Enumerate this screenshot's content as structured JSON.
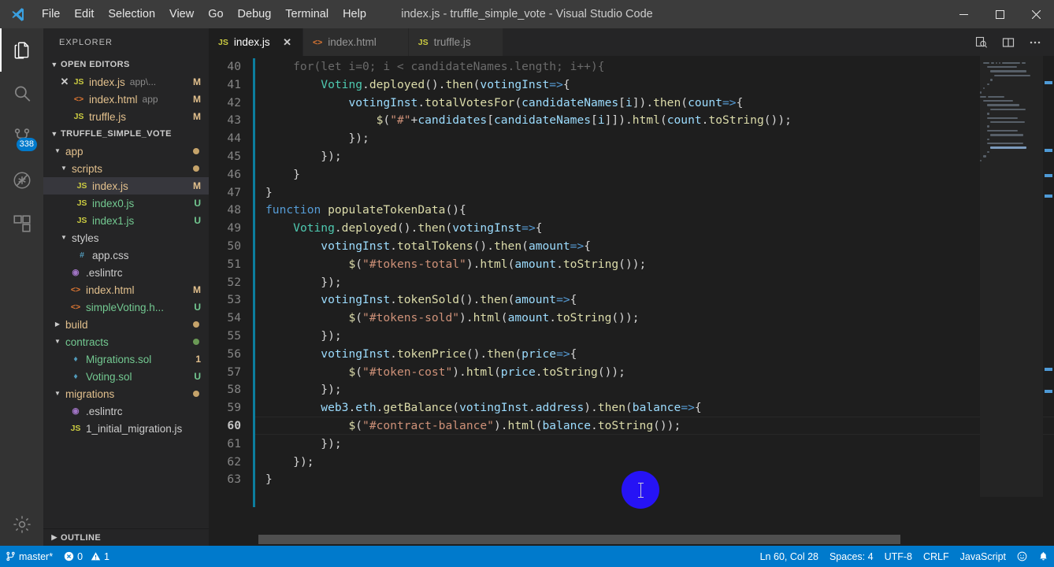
{
  "window": {
    "title": "index.js - truffle_simple_vote - Visual Studio Code",
    "minimize_label": "Minimize",
    "maximize_label": "Maximize",
    "close_label": "Close"
  },
  "menu": [
    {
      "label": "File"
    },
    {
      "label": "Edit"
    },
    {
      "label": "Selection"
    },
    {
      "label": "View"
    },
    {
      "label": "Go"
    },
    {
      "label": "Debug"
    },
    {
      "label": "Terminal"
    },
    {
      "label": "Help"
    }
  ],
  "activitybar": [
    {
      "name": "explorer",
      "icon": "files-icon",
      "active": true,
      "badge": ""
    },
    {
      "name": "search",
      "icon": "search-icon",
      "active": false,
      "badge": ""
    },
    {
      "name": "source-control",
      "icon": "source-control-icon",
      "active": false,
      "badge": "338"
    },
    {
      "name": "debug",
      "icon": "debug-icon",
      "active": false,
      "badge": ""
    },
    {
      "name": "extensions",
      "icon": "extensions-icon",
      "active": false,
      "badge": ""
    },
    {
      "name": "settings",
      "icon": "gear-icon",
      "active": false,
      "badge": ""
    }
  ],
  "sidebar": {
    "title": "EXPLORER",
    "open_editors": {
      "label": "OPEN EDITORS",
      "items": [
        {
          "icon": "js",
          "name": "index.js",
          "sub": "app\\...",
          "badge": "M",
          "badge_kind": "M",
          "name_kind": "mod",
          "closable": true,
          "selected": false
        },
        {
          "icon": "html",
          "name": "index.html",
          "sub": "app",
          "badge": "M",
          "badge_kind": "M",
          "name_kind": "mod",
          "closable": false,
          "selected": false
        },
        {
          "icon": "js",
          "name": "truffle.js",
          "sub": "",
          "badge": "M",
          "badge_kind": "M",
          "name_kind": "mod",
          "closable": false,
          "selected": false
        }
      ]
    },
    "project": {
      "label": "TRUFFLE_SIMPLE_VOTE",
      "items": [
        {
          "indent": 1,
          "twisty": "down",
          "icon": "",
          "name": "app",
          "badge": "",
          "badge_kind": "dot-orange",
          "name_kind": "mod",
          "selected": false
        },
        {
          "indent": 2,
          "twisty": "down",
          "icon": "",
          "name": "scripts",
          "badge": "",
          "badge_kind": "dot-orange",
          "name_kind": "mod",
          "selected": false
        },
        {
          "indent": 3,
          "twisty": "none",
          "icon": "js",
          "name": "index.js",
          "badge": "M",
          "badge_kind": "M",
          "name_kind": "mod",
          "selected": true
        },
        {
          "indent": 3,
          "twisty": "none",
          "icon": "js",
          "name": "index0.js",
          "badge": "U",
          "badge_kind": "U",
          "name_kind": "untracked",
          "selected": false
        },
        {
          "indent": 3,
          "twisty": "none",
          "icon": "js",
          "name": "index1.js",
          "badge": "U",
          "badge_kind": "U",
          "name_kind": "untracked",
          "selected": false
        },
        {
          "indent": 2,
          "twisty": "down",
          "icon": "",
          "name": "styles",
          "badge": "",
          "badge_kind": "",
          "name_kind": "default",
          "selected": false
        },
        {
          "indent": 3,
          "twisty": "none",
          "icon": "css",
          "name": "app.css",
          "badge": "",
          "badge_kind": "",
          "name_kind": "default",
          "selected": false
        },
        {
          "indent": 2,
          "twisty": "none",
          "icon": "eslint",
          "name": ".eslintrc",
          "badge": "",
          "badge_kind": "",
          "name_kind": "default",
          "selected": false
        },
        {
          "indent": 2,
          "twisty": "none",
          "icon": "html",
          "name": "index.html",
          "badge": "M",
          "badge_kind": "M",
          "name_kind": "mod",
          "selected": false
        },
        {
          "indent": 2,
          "twisty": "none",
          "icon": "html",
          "name": "simpleVoting.h...",
          "badge": "U",
          "badge_kind": "U",
          "name_kind": "untracked",
          "selected": false
        },
        {
          "indent": 1,
          "twisty": "right",
          "icon": "",
          "name": "build",
          "badge": "",
          "badge_kind": "dot-orange",
          "name_kind": "mod",
          "selected": false
        },
        {
          "indent": 1,
          "twisty": "down",
          "icon": "",
          "name": "contracts",
          "badge": "",
          "badge_kind": "dot-green",
          "name_kind": "untracked",
          "selected": false
        },
        {
          "indent": 2,
          "twisty": "none",
          "icon": "sol",
          "name": "Migrations.sol",
          "badge": "1",
          "badge_kind": "num",
          "name_kind": "untracked",
          "selected": false
        },
        {
          "indent": 2,
          "twisty": "none",
          "icon": "sol",
          "name": "Voting.sol",
          "badge": "U",
          "badge_kind": "U",
          "name_kind": "untracked",
          "selected": false
        },
        {
          "indent": 1,
          "twisty": "down",
          "icon": "",
          "name": "migrations",
          "badge": "",
          "badge_kind": "dot-orange",
          "name_kind": "mod",
          "selected": false
        },
        {
          "indent": 2,
          "twisty": "none",
          "icon": "eslint",
          "name": ".eslintrc",
          "badge": "",
          "badge_kind": "",
          "name_kind": "default",
          "selected": false
        },
        {
          "indent": 2,
          "twisty": "none",
          "icon": "js",
          "name": "1_initial_migration.js",
          "badge": "",
          "badge_kind": "",
          "name_kind": "default",
          "selected": false
        }
      ]
    },
    "outline_label": "OUTLINE"
  },
  "tabs": [
    {
      "icon": "js",
      "label": "index.js",
      "active": true,
      "closable": true
    },
    {
      "icon": "html",
      "label": "index.html",
      "active": false,
      "closable": false
    },
    {
      "icon": "js",
      "label": "truffle.js",
      "active": false,
      "closable": false
    }
  ],
  "editor_actions": [
    {
      "name": "open-changes-icon"
    },
    {
      "name": "split-editor-icon"
    },
    {
      "name": "more-actions-icon"
    }
  ],
  "code": {
    "first_line": 40,
    "current_line": 60,
    "lines": [
      {
        "no": 40,
        "html": "<span class='t-dim'>    for(let i=0; i &lt; candidateNames.length; i++){</span>"
      },
      {
        "no": 41,
        "html": "        <span class='t-cls'>Voting</span><span class='t-pun'>.</span><span class='t-fn'>deployed</span><span class='t-pun'>().</span><span class='t-fn'>then</span><span class='t-pun'>(</span><span class='t-var'>votingInst</span><span class='t-kw'>=&gt;</span><span class='t-pun'>{</span>"
      },
      {
        "no": 42,
        "html": "            <span class='t-var'>votingInst</span><span class='t-pun'>.</span><span class='t-fn'>totalVotesFor</span><span class='t-pun'>(</span><span class='t-var'>candidateNames</span><span class='t-pun'>[</span><span class='t-var'>i</span><span class='t-pun'>]).</span><span class='t-fn'>then</span><span class='t-pun'>(</span><span class='t-var'>count</span><span class='t-kw'>=&gt;</span><span class='t-pun'>{</span>"
      },
      {
        "no": 43,
        "html": "                <span class='t-fn'>$</span><span class='t-pun'>(</span><span class='t-str'>\"#\"</span><span class='t-op'>+</span><span class='t-var'>candidates</span><span class='t-pun'>[</span><span class='t-var'>candidateNames</span><span class='t-pun'>[</span><span class='t-var'>i</span><span class='t-pun'>]]).</span><span class='t-fn'>html</span><span class='t-pun'>(</span><span class='t-var'>count</span><span class='t-pun'>.</span><span class='t-fn'>toString</span><span class='t-pun'>());</span>"
      },
      {
        "no": 44,
        "html": "            <span class='t-pun'>});</span>"
      },
      {
        "no": 45,
        "html": "        <span class='t-pun'>});</span>"
      },
      {
        "no": 46,
        "html": "    <span class='t-pun'>}</span>"
      },
      {
        "no": 47,
        "html": "<span class='t-pun'>}</span>"
      },
      {
        "no": 48,
        "html": "<span class='t-kw'>function</span> <span class='t-fn'>populateTokenData</span><span class='t-pun'>(){</span>"
      },
      {
        "no": 49,
        "html": "    <span class='t-cls'>Voting</span><span class='t-pun'>.</span><span class='t-fn'>deployed</span><span class='t-pun'>().</span><span class='t-fn'>then</span><span class='t-pun'>(</span><span class='t-var'>votingInst</span><span class='t-kw'>=&gt;</span><span class='t-pun'>{</span>"
      },
      {
        "no": 50,
        "html": "        <span class='t-var'>votingInst</span><span class='t-pun'>.</span><span class='t-fn'>totalTokens</span><span class='t-pun'>().</span><span class='t-fn'>then</span><span class='t-pun'>(</span><span class='t-var'>amount</span><span class='t-kw'>=&gt;</span><span class='t-pun'>{</span>"
      },
      {
        "no": 51,
        "html": "            <span class='t-fn'>$</span><span class='t-pun'>(</span><span class='t-str'>\"#tokens-total\"</span><span class='t-pun'>).</span><span class='t-fn'>html</span><span class='t-pun'>(</span><span class='t-var'>amount</span><span class='t-pun'>.</span><span class='t-fn'>toString</span><span class='t-pun'>());</span>"
      },
      {
        "no": 52,
        "html": "        <span class='t-pun'>});</span>"
      },
      {
        "no": 53,
        "html": "        <span class='t-var'>votingInst</span><span class='t-pun'>.</span><span class='t-fn'>tokenSold</span><span class='t-pun'>().</span><span class='t-fn'>then</span><span class='t-pun'>(</span><span class='t-var'>amount</span><span class='t-kw'>=&gt;</span><span class='t-pun'>{</span>"
      },
      {
        "no": 54,
        "html": "            <span class='t-fn'>$</span><span class='t-pun'>(</span><span class='t-str'>\"#tokens-sold\"</span><span class='t-pun'>).</span><span class='t-fn'>html</span><span class='t-pun'>(</span><span class='t-var'>amount</span><span class='t-pun'>.</span><span class='t-fn'>toString</span><span class='t-pun'>());</span>"
      },
      {
        "no": 55,
        "html": "        <span class='t-pun'>});</span>"
      },
      {
        "no": 56,
        "html": "        <span class='t-var'>votingInst</span><span class='t-pun'>.</span><span class='t-fn'>tokenPrice</span><span class='t-pun'>().</span><span class='t-fn'>then</span><span class='t-pun'>(</span><span class='t-var'>price</span><span class='t-kw'>=&gt;</span><span class='t-pun'>{</span>"
      },
      {
        "no": 57,
        "html": "            <span class='t-fn'>$</span><span class='t-pun'>(</span><span class='t-str'>\"#token-cost\"</span><span class='t-pun'>).</span><span class='t-fn'>html</span><span class='t-pun'>(</span><span class='t-var'>price</span><span class='t-pun'>.</span><span class='t-fn'>toString</span><span class='t-pun'>());</span>"
      },
      {
        "no": 58,
        "html": "        <span class='t-pun'>});</span>"
      },
      {
        "no": 59,
        "html": "        <span class='t-var'>web3</span><span class='t-pun'>.</span><span class='t-var'>eth</span><span class='t-pun'>.</span><span class='t-fn'>getBalance</span><span class='t-pun'>(</span><span class='t-var'>votingInst</span><span class='t-pun'>.</span><span class='t-var'>address</span><span class='t-pun'>).</span><span class='t-fn'>then</span><span class='t-pun'>(</span><span class='t-var'>balance</span><span class='t-kw'>=&gt;</span><span class='t-pun'>{</span>"
      },
      {
        "no": 60,
        "html": "            <span class='t-fn'>$</span><span class='t-pun'>(</span><span class='t-str'>\"#contract-balance\"</span><span class='t-pun'>).</span><span class='t-fn'>html</span><span class='t-pun'>(</span><span class='t-var'>balance</span><span class='t-pun'>.</span><span class='t-fn'>toString</span><span class='t-pun'>());</span>"
      },
      {
        "no": 61,
        "html": "        <span class='t-pun'>});</span>"
      },
      {
        "no": 62,
        "html": "    <span class='t-pun'>});</span>"
      },
      {
        "no": 63,
        "html": "<span class='t-pun'>}</span>"
      }
    ]
  },
  "statusbar": {
    "branch": "master*",
    "errors": "0",
    "warnings": "1",
    "position": "Ln 60, Col 28",
    "indent": "Spaces: 4",
    "encoding": "UTF-8",
    "eol": "CRLF",
    "language": "JavaScript",
    "feedback_icon": "smiley-icon",
    "notifications_icon": "bell-icon"
  },
  "colors": {
    "accent": "#007acc",
    "titlebar": "#3c3c3c",
    "sidebar": "#252526",
    "editor": "#1e1e1e",
    "activitybar": "#333333",
    "click_indicator": "#2613f5",
    "git_gutter": "#0c7d9d"
  }
}
